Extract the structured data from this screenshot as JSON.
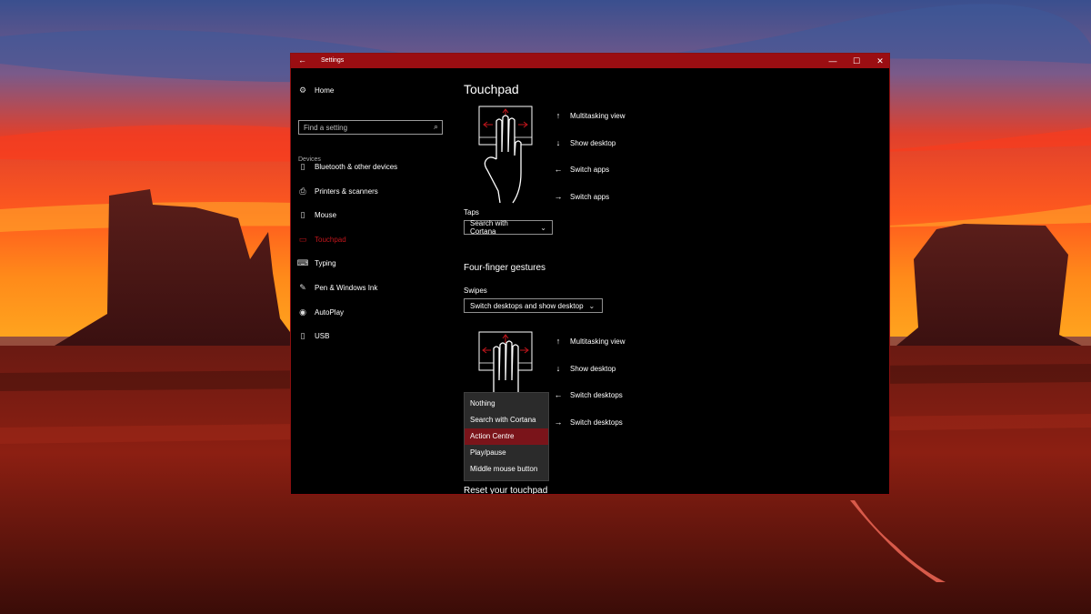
{
  "window": {
    "title": "Settings",
    "back_icon": "←",
    "minimize_icon": "—",
    "maximize_icon": "☐",
    "close_icon": "✕"
  },
  "sidebar": {
    "home_label": "Home",
    "search_placeholder": "Find a setting",
    "section_label": "Devices",
    "items": [
      {
        "label": "Bluetooth & other devices",
        "icon": "bluetooth-icon"
      },
      {
        "label": "Printers & scanners",
        "icon": "printer-icon"
      },
      {
        "label": "Mouse",
        "icon": "mouse-icon"
      },
      {
        "label": "Touchpad",
        "icon": "touchpad-icon",
        "active": true
      },
      {
        "label": "Typing",
        "icon": "keyboard-icon"
      },
      {
        "label": "Pen & Windows Ink",
        "icon": "pen-icon"
      },
      {
        "label": "AutoPlay",
        "icon": "autoplay-icon"
      },
      {
        "label": "USB",
        "icon": "usb-icon"
      }
    ]
  },
  "content": {
    "page_title": "Touchpad",
    "three_finger": {
      "gestures": [
        {
          "direction": "up",
          "label": "Multitasking view"
        },
        {
          "direction": "down",
          "label": "Show desktop"
        },
        {
          "direction": "left",
          "label": "Switch apps"
        },
        {
          "direction": "right",
          "label": "Switch apps"
        }
      ],
      "taps_label": "Taps",
      "taps_value": "Search with Cortana"
    },
    "four_finger": {
      "title": "Four-finger gestures",
      "swipes_label": "Swipes",
      "swipes_value": "Switch desktops and show desktop",
      "gestures": [
        {
          "direction": "up",
          "label": "Multitasking view"
        },
        {
          "direction": "down",
          "label": "Show desktop"
        },
        {
          "direction": "left",
          "label": "Switch desktops"
        },
        {
          "direction": "right",
          "label": "Switch desktops"
        }
      ],
      "taps_options": [
        "Nothing",
        "Search with Cortana",
        "Action Centre",
        "Play/pause",
        "Middle mouse button"
      ],
      "taps_selected": "Action Centre"
    },
    "reset_title": "Reset your touchpad"
  },
  "colors": {
    "accent": "#c2161c",
    "titlebar": "#9b0e12",
    "popup_selected": "#7a141a"
  }
}
